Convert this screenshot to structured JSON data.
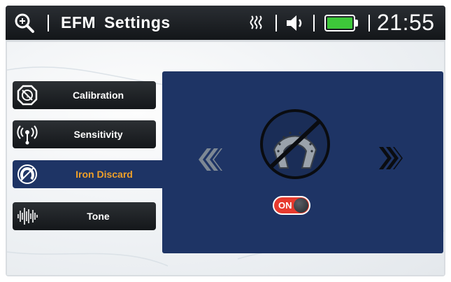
{
  "header": {
    "title": "EFM  Settings",
    "time": "21:55",
    "icons": [
      "search-zoom-icon",
      "signal-strength-icon",
      "speaker-icon",
      "battery-icon"
    ],
    "battery_color": "#3ec83a"
  },
  "menu": {
    "items": [
      {
        "label": "Calibration",
        "icon": "calibration-icon",
        "active": false
      },
      {
        "label": "Sensitivity",
        "icon": "sensitivity-icon",
        "active": false
      },
      {
        "label": "Iron Discard",
        "icon": "iron-discard-icon",
        "active": true
      },
      {
        "label": "Tone",
        "icon": "tone-icon",
        "active": false
      }
    ],
    "active_color": "#1e3465",
    "active_label_color": "#f0a028"
  },
  "panel": {
    "icon": "horseshoe-prohibited-icon",
    "toggle": {
      "label": "ON",
      "state": "on",
      "color": "#e63a2e"
    },
    "nav": {
      "prev": "arrow-left-icon",
      "next": "arrow-right-icon"
    }
  }
}
